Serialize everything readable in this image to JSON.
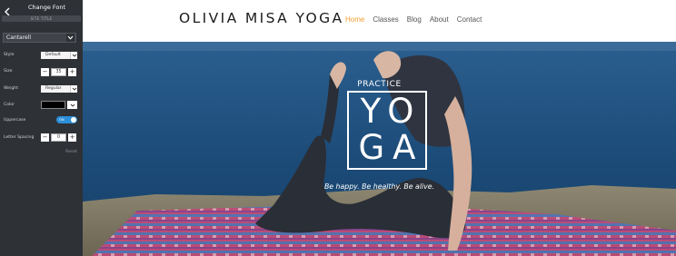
{
  "panel": {
    "title": "Change Font",
    "section_label": "SITE TITLE",
    "font_family_value": "Cantarell",
    "style": {
      "label": "Style",
      "value": "Default"
    },
    "size": {
      "label": "Size",
      "value": "35",
      "minus": "−",
      "plus": "+"
    },
    "weight": {
      "label": "Weight",
      "value": "Regular"
    },
    "color": {
      "label": "Color",
      "value": "#000000"
    },
    "uppercase": {
      "label": "Uppercase",
      "state_text": "ON",
      "enabled": true
    },
    "letter_spacing": {
      "label": "Letter Spacing",
      "value": "0",
      "minus": "−",
      "plus": "+"
    },
    "reset_label": "Reset",
    "icons": {
      "back": "chevron-left-icon",
      "dropdown": "chevron-down-icon"
    },
    "colors": {
      "panel_bg": "#2e3136",
      "toggle_on": "#2d8fd8"
    }
  },
  "site": {
    "logo": "OLIVIA MISA YOGA",
    "nav": [
      {
        "label": "Home",
        "active": true
      },
      {
        "label": "Classes",
        "active": false
      },
      {
        "label": "Blog",
        "active": false
      },
      {
        "label": "About",
        "active": false
      },
      {
        "label": "Contact",
        "active": false
      }
    ],
    "hero": {
      "kicker": "PRACTICE",
      "title_line1": "YO",
      "title_line2": "GA",
      "tagline": "Be happy. Be healthy. Be alive."
    },
    "colors": {
      "nav_active": "#f0a030",
      "sea": "#1d4f7c"
    }
  }
}
